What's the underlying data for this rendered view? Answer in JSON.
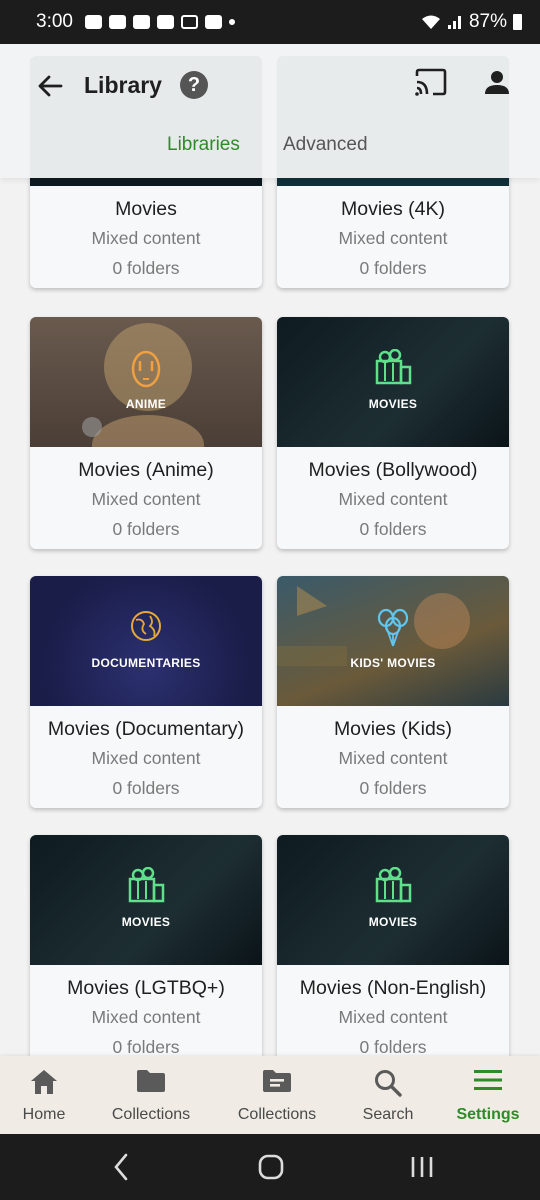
{
  "status_bar": {
    "time": "3:00",
    "battery": "87%"
  },
  "header": {
    "title": "Library",
    "help": "?"
  },
  "tabs": [
    {
      "label": "Libraries",
      "active": true
    },
    {
      "label": "Advanced",
      "active": false
    }
  ],
  "libraries": [
    {
      "title": "Movies",
      "content": "Mixed content",
      "folders": "0 folders",
      "thumb": "partial"
    },
    {
      "title": "Movies (4K)",
      "content": "Mixed content",
      "folders": "0 folders",
      "thumb": "partial"
    },
    {
      "title": "Movies (Anime)",
      "content": "Mixed content",
      "folders": "0 folders",
      "thumb_label": "ANIME"
    },
    {
      "title": "Movies (Bollywood)",
      "content": "Mixed content",
      "folders": "0 folders",
      "thumb_label": "MOVIES"
    },
    {
      "title": "Movies (Documentary)",
      "content": "Mixed content",
      "folders": "0 folders",
      "thumb_label": "DOCUMENTARIES"
    },
    {
      "title": "Movies (Kids)",
      "content": "Mixed content",
      "folders": "0 folders",
      "thumb_label": "KIDS' MOVIES"
    },
    {
      "title": "Movies (LGTBQ+)",
      "content": "Mixed content",
      "folders": "0 folders",
      "thumb_label": "MOVIES"
    },
    {
      "title": "Movies (Non-English)",
      "content": "Mixed content",
      "folders": "0 folders",
      "thumb_label": "MOVIES"
    }
  ],
  "bottom_nav": [
    {
      "label": "Home",
      "icon": "home-icon",
      "active": false
    },
    {
      "label": "Collections",
      "icon": "folder-icon",
      "active": false
    },
    {
      "label": "Collections",
      "icon": "collection-icon",
      "active": false
    },
    {
      "label": "Search",
      "icon": "search-icon",
      "active": false
    },
    {
      "label": "Settings",
      "icon": "menu-icon",
      "active": true
    }
  ],
  "colors": {
    "accent": "#2e8b28",
    "movies_icon": "#5fe08a",
    "anime_icon": "#f0a040",
    "doc_icon": "#e6a838",
    "kids_icon": "#5fc6f0"
  }
}
